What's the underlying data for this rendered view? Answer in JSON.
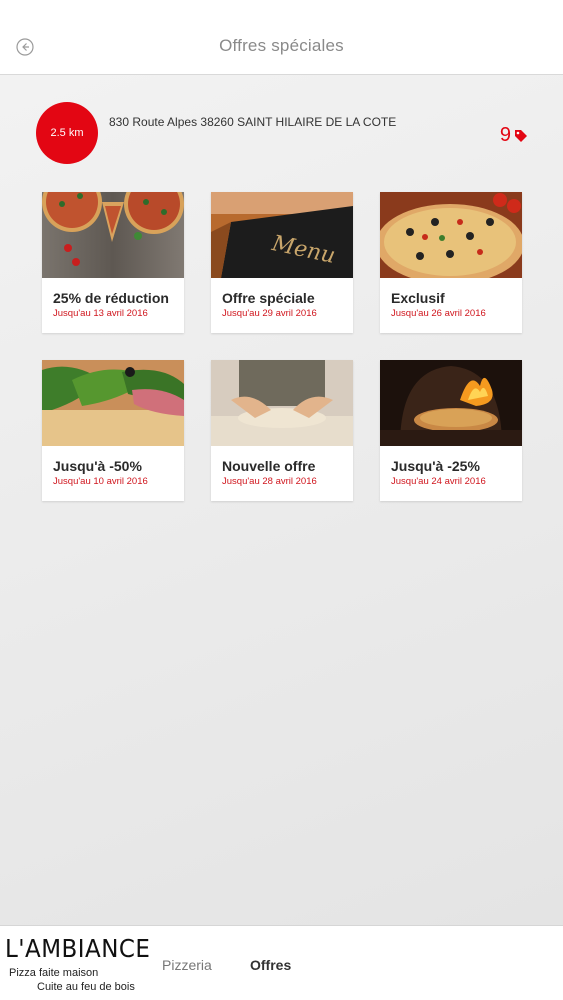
{
  "header": {
    "title": "Offres spéciales",
    "back_icon": "back-arrow-icon"
  },
  "store": {
    "distance": "2.5 km",
    "address": "830 Route Alpes 38260 SAINT HILAIRE DE LA COTE",
    "offer_count": "9",
    "accent_color": "#e30613"
  },
  "offers": [
    {
      "title": "25% de réduction",
      "date": "Jusqu'au 13 avril 2016",
      "image": "pizzas-on-wood"
    },
    {
      "title": "Offre spéciale",
      "date": "Jusqu'au 29 avril 2016",
      "image": "menu-card"
    },
    {
      "title": "Exclusif",
      "date": "Jusqu'au 26 avril 2016",
      "image": "pizza-olives"
    },
    {
      "title": "Jusqu'à -50%",
      "date": "Jusqu'au 10 avril 2016",
      "image": "salad-ham-pizza"
    },
    {
      "title": "Nouvelle offre",
      "date": "Jusqu'au 28 avril 2016",
      "image": "dough-kneading"
    },
    {
      "title": "Jusqu'à -25%",
      "date": "Jusqu'au 24 avril 2016",
      "image": "wood-fired-oven"
    }
  ],
  "footer": {
    "brand": "L'AMBIANCE",
    "tagline_1": "Pizza faite maison",
    "tagline_2": "Cuite au feu de bois",
    "nav": [
      "Pizzeria",
      "Offres"
    ],
    "active_nav": "Offres"
  }
}
